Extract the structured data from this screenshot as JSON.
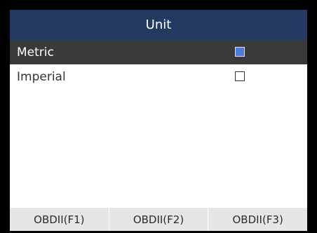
{
  "header": {
    "title": "Unit"
  },
  "options": [
    {
      "label": "Metric",
      "checked": true
    },
    {
      "label": "Imperial",
      "checked": false
    }
  ],
  "footer": {
    "keys": [
      "OBDII(F1)",
      "OBDII(F2)",
      "OBDII(F3)"
    ]
  },
  "colors": {
    "header_bg": "#243a63",
    "selected_row_bg": "#3a3a3a",
    "checkbox_checked": "#4f7bd9",
    "footer_bg": "#e6e6e6"
  }
}
